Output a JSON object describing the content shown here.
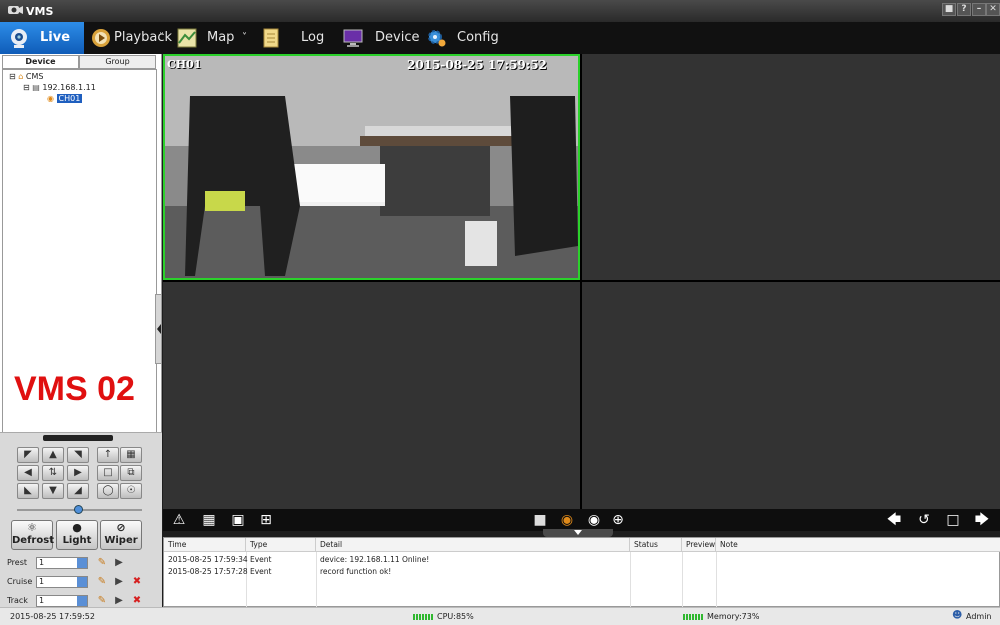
{
  "window": {
    "title": "VMS"
  },
  "nav": {
    "tabs": [
      {
        "label": "Live"
      },
      {
        "label": "Playback"
      },
      {
        "label": "Map"
      },
      {
        "label": "Log"
      },
      {
        "label": "Device"
      },
      {
        "label": "Config"
      }
    ],
    "playback_dropdown": "˅",
    "map_dropdown": "˅"
  },
  "left_panel": {
    "tabs": [
      "Device",
      "Group"
    ],
    "tree": {
      "root": "CMS",
      "device": "192.168.1.11",
      "channel": "CH01"
    },
    "watermark": "VMS 02",
    "ptz": {
      "buttons": [
        "Defrost",
        "Light",
        "Wiper"
      ],
      "preset": {
        "label": "Prest",
        "value": "1"
      },
      "cruise": {
        "label": "Cruise",
        "value": "1"
      },
      "track": {
        "label": "Track",
        "value": "1"
      }
    }
  },
  "video": {
    "cell1": {
      "channel": "CH01",
      "timestamp": "2015-08-25 17:59:52"
    }
  },
  "log": {
    "columns": [
      "Time",
      "Type",
      "Detail",
      "Status",
      "Preview",
      "Note"
    ],
    "rows": [
      {
        "time": "2015-08-25  17:59:34",
        "type": "Event",
        "detail": "device: 192.168.1.11   Online!"
      },
      {
        "time": "2015-08-25  17:57:28",
        "type": "Event",
        "detail": "record function ok!"
      }
    ]
  },
  "status": {
    "datetime": "2015-08-25  17:59:52",
    "cpu": "CPU:85%",
    "memory": "Memory:73%",
    "user": "Admin"
  },
  "colors": {
    "active_tab": "#1a6fd0",
    "selected_cell_border": "#2bd12b",
    "watermark": "#e01010",
    "meter": "#2fb82f"
  }
}
